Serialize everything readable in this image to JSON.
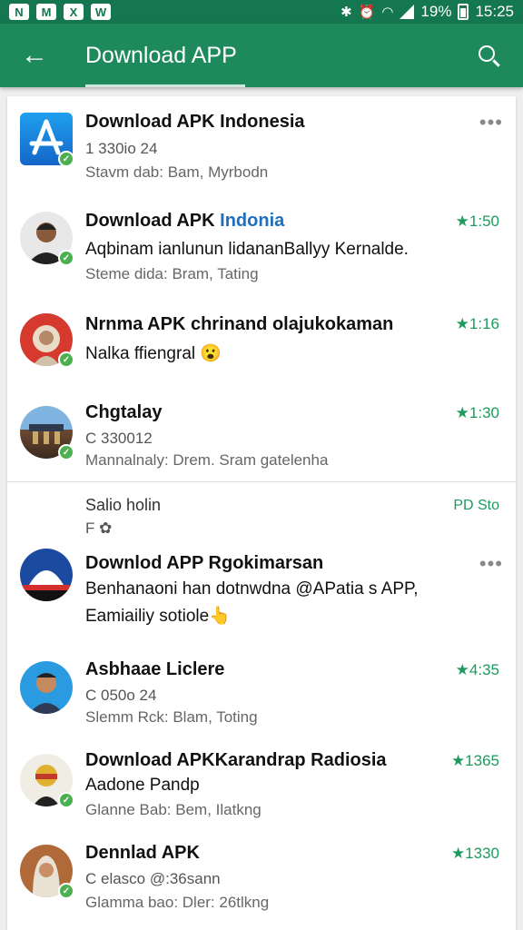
{
  "status_bar": {
    "battery": "19%",
    "time": "15:25",
    "app_icons": [
      "N",
      "M",
      "X",
      "W"
    ]
  },
  "app_bar": {
    "title": "Download APP"
  },
  "section": {
    "title": "Salio holin",
    "subtitle": "F ✿",
    "right": "PD Sto"
  },
  "items": [
    {
      "title": "Download APK Indonesia",
      "line2": "1 330io 24",
      "meta": "Stavm dab: Bam, Myrbodn",
      "rating": "",
      "more": "•••"
    },
    {
      "title": "Download APK ",
      "title_accent": "Indonia",
      "line2": "Aqbinam ianlunun lidananBallyy Kernalde.",
      "meta": "Steme dida: Bram, Tating",
      "rating": "★1:50"
    },
    {
      "title": "Nrnma APK chrinand olajukokaman",
      "line2": "Nalka ffiengral 😮",
      "rating": "★1:16"
    },
    {
      "title": "Chgtalay",
      "line2": "C 330012",
      "meta": "Mannalnaly: Drem. Sram gatelenha",
      "rating": "★1:30"
    },
    {
      "title": "Downlod APP Rgokimarsan",
      "line2": "Benhanaoni han dotnwdna @APatia s APP,",
      "line3": "Eamiailiy sotiole👆",
      "more": "•••"
    },
    {
      "title": "Asbhaae Liclere",
      "line2": "C 050o 24",
      "meta": "Slemm Rck: Blam, Toting",
      "rating": "★4:35"
    },
    {
      "title": "Download APKKarandrap Radiosia",
      "line2": "Aadone Pandp",
      "meta": "Glanne Bab: Bem, Ilatkng",
      "rating": "★1365"
    },
    {
      "title": "Dennlad APK",
      "line2": "C elasco @:36sann",
      "meta": "Glamma bao: Dler: 26tlkng",
      "rating": "★1330"
    }
  ],
  "colors": {
    "status_bar": "#14774f",
    "app_bar": "#1e8a5b",
    "accent_green": "#1e9a5e",
    "link_blue": "#1f6fbf"
  }
}
